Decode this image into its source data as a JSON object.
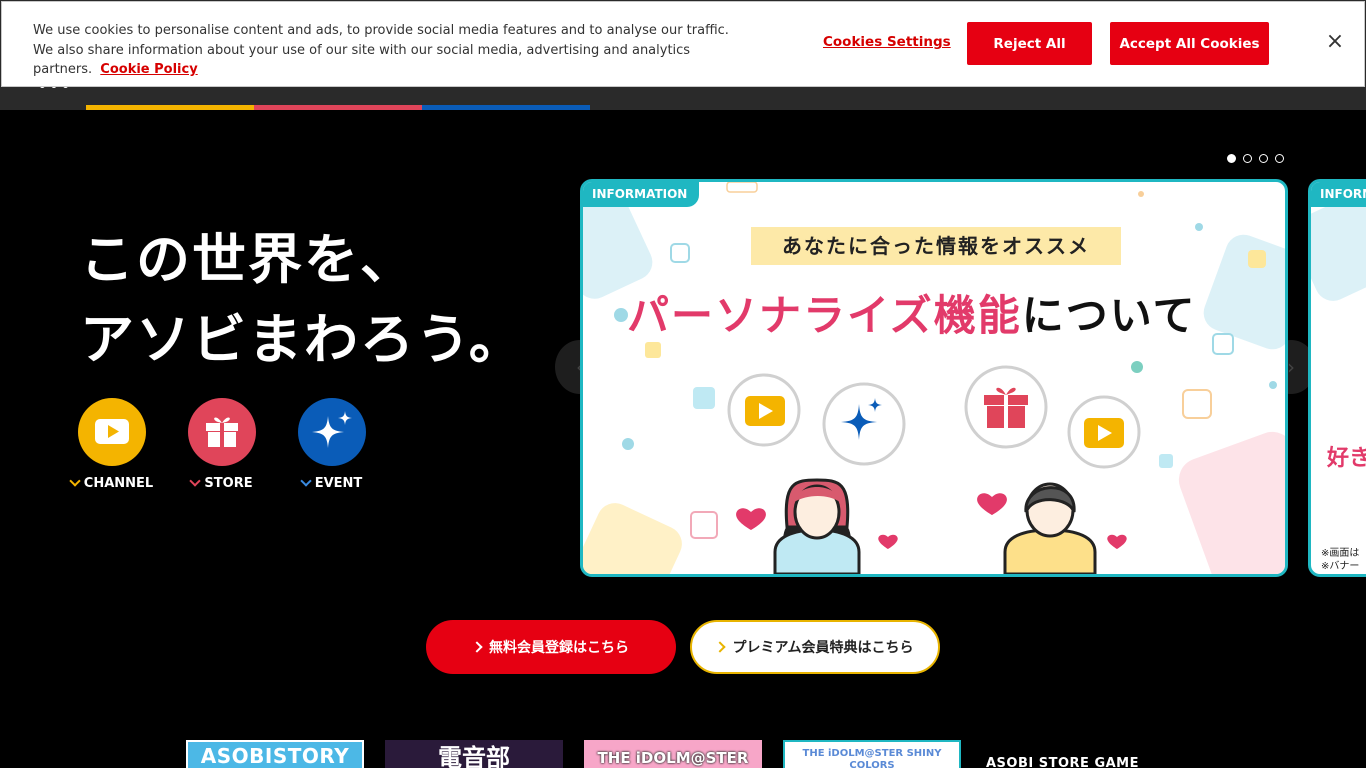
{
  "cookie_banner": {
    "text": "We use cookies to personalise content and ads, to provide social media features and to analyse our traffic. We also share information about your use of our site with our social media, advertising and analytics partners.",
    "policy_link": "Cookie Policy",
    "settings_label": "Cookies Settings",
    "reject_label": "Reject All",
    "accept_label": "Accept All Cookies",
    "close_label": "×"
  },
  "nav": {
    "menu_dots": "•••"
  },
  "hero": {
    "title_line1": "この世界を、",
    "title_line2": "アソビまわろう。"
  },
  "categories": [
    {
      "label": "CHANNEL",
      "icon": "play-icon",
      "color": "#f4b400"
    },
    {
      "label": "STORE",
      "icon": "gift-icon",
      "color": "#e0455a"
    },
    {
      "label": "EVENT",
      "icon": "sparkle-icon",
      "color": "#0a5cb8"
    }
  ],
  "carousel": {
    "active_index": 0,
    "slide_count": 4,
    "main_card": {
      "tag": "INFORMATION",
      "subtitle": "あなたに合った情報をオススメ",
      "title_pink": "パーソナライズ機能",
      "title_dark": "について"
    },
    "next_card": {
      "tag": "INFORMATION",
      "text": "好き",
      "note_line1": "※画面は",
      "note_line2": "※バナー"
    }
  },
  "cta": {
    "free_label": "無料会員登録はこちら",
    "premium_label": "プレミアム会員特典はこちら"
  },
  "logos": [
    {
      "text": "ASOBISTORY"
    },
    {
      "text": "電音部"
    },
    {
      "text": "THE iDOLM@STER"
    },
    {
      "text": "THE iDOLM@STER SHINY COLORS"
    },
    {
      "text": "ASOBI STORE GAME"
    }
  ],
  "colors": {
    "accent_red": "#e60012",
    "teal": "#1fb7c2",
    "channel": "#f4b400",
    "store": "#e0455a",
    "event": "#0a5cb8"
  }
}
